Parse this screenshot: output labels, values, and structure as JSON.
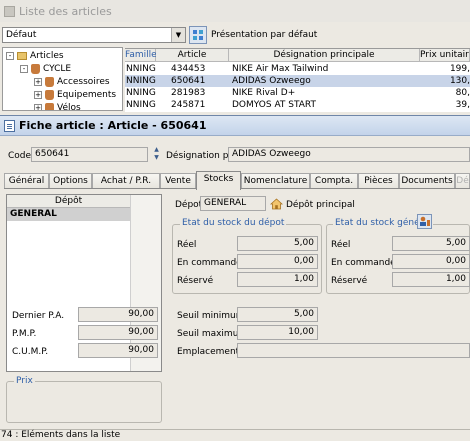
{
  "background_window": {
    "title": "Liste des articles",
    "view_combo_value": "Défaut",
    "presentation_label": "Présentation par défaut",
    "tree": [
      {
        "label": "Articles",
        "level": 0,
        "toggle": "-"
      },
      {
        "label": "CYCLE",
        "level": 1,
        "toggle": "-"
      },
      {
        "label": "Accessoires",
        "level": 2,
        "toggle": "+"
      },
      {
        "label": "Equipements",
        "level": 2,
        "toggle": "+"
      },
      {
        "label": "Vélos",
        "level": 2,
        "toggle": "+"
      }
    ],
    "grid": {
      "columns": [
        "Famille",
        "Article",
        "Désignation principale",
        "Prix unitaire"
      ],
      "rows": [
        {
          "famille": "NNING",
          "article": "434453",
          "designation": "NIKE Air Max Tailwind",
          "prix": "199,"
        },
        {
          "famille": "NNING",
          "article": "650641",
          "designation": "ADIDAS Ozweego",
          "prix": "130,"
        },
        {
          "famille": "NNING",
          "article": "281983",
          "designation": "NIKE Rival D+",
          "prix": "80,"
        },
        {
          "famille": "NNING",
          "article": "245871",
          "designation": "DOMYOS AT START",
          "prix": "39,"
        }
      ]
    }
  },
  "fiche": {
    "title": "Fiche article : Article - 650641",
    "code_label": "Code",
    "code_value": "650641",
    "designation_label": "Désignation pr.",
    "designation_value": "ADIDAS Ozweego",
    "tabs": [
      "Général",
      "Options",
      "Achat / P.R.",
      "Vente",
      "Stocks",
      "Nomenclature",
      "Compta.",
      "Pièces",
      "Documents",
      "Dé"
    ],
    "active_tab": "Stocks",
    "depot_list": {
      "header": "Dépôt",
      "selected": "GENERAL"
    },
    "depot_label": "Dépot",
    "depot_code": "GENERAL",
    "depot_name": "Dépôt principal",
    "stock_depot": {
      "title": "Etat du stock du dépot",
      "reel_label": "Réel",
      "reel": "5,00",
      "commande_label": "En commande",
      "commande": "0,00",
      "reserve_label": "Réservé",
      "reserve": "1,00"
    },
    "stock_general": {
      "title": "Etat du stock général",
      "reel_label": "Réel",
      "reel": "5,00",
      "commande_label": "En commande",
      "commande": "0,00",
      "reserve_label": "Réservé",
      "reserve": "1,00"
    },
    "prix": {
      "title": "Prix",
      "dernier_label": "Dernier P.A.",
      "dernier": "90,00",
      "pmp_label": "P.M.P.",
      "pmp": "90,00",
      "cump_label": "C.U.M.P.",
      "cump": "90,00"
    },
    "seuils": {
      "min_label": "Seuil minimum",
      "min": "5,00",
      "max_label": "Seuil maximum",
      "max": "10,00",
      "emplacement_label": "Emplacement",
      "emplacement": ""
    }
  },
  "status_bar": {
    "text": "74 : Eléments dans la liste"
  },
  "colors": {
    "accent": "#2f5fa8",
    "title_bar": "#c3d3ea",
    "selected_row": "#c8d4e8"
  }
}
